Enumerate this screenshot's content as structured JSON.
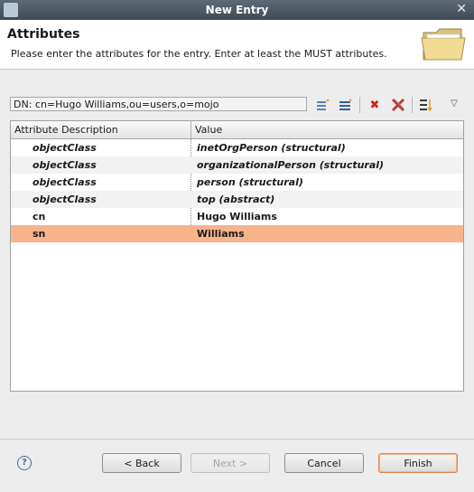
{
  "window": {
    "title": "New Entry",
    "close_glyph": "✕"
  },
  "header": {
    "title": "Attributes",
    "description": "Please enter the attributes for the entry. Enter at least the MUST attributes.",
    "icon": "folder-icon"
  },
  "dn": {
    "value": "DN: cn=Hugo Williams,ou=users,o=mojo"
  },
  "toolbar": {
    "icons": [
      "new-attribute-icon",
      "new-value-icon",
      "delete-icon",
      "delete-all-icon",
      "sort-icon",
      "view-menu-icon"
    ]
  },
  "table": {
    "columns": [
      "Attribute Description",
      "Value"
    ],
    "rows": [
      {
        "attribute": "objectClass",
        "value": "inetOrgPerson (structural)",
        "italic": true
      },
      {
        "attribute": "objectClass",
        "value": "organizationalPerson (structural)",
        "italic": true
      },
      {
        "attribute": "objectClass",
        "value": "person (structural)",
        "italic": true
      },
      {
        "attribute": "objectClass",
        "value": "top (abstract)",
        "italic": true
      },
      {
        "attribute": "cn",
        "value": "Hugo Williams",
        "italic": false
      },
      {
        "attribute": "sn",
        "value": "Williams",
        "italic": false,
        "selected": true
      }
    ]
  },
  "buttons": {
    "help": "?",
    "back": "< Back",
    "next": "Next >",
    "cancel": "Cancel",
    "finish": "Finish"
  },
  "colors": {
    "selection": "#f7b48a",
    "focus_border": "#e0834a"
  }
}
